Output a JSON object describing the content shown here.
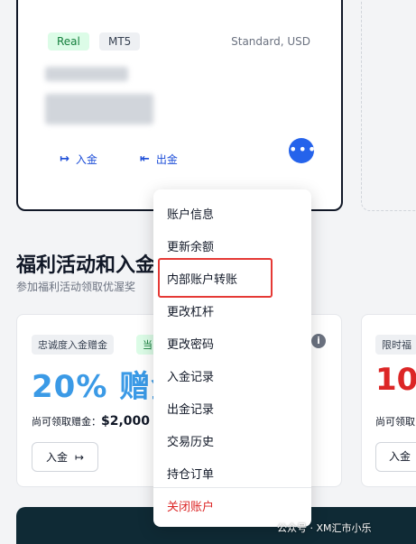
{
  "account": {
    "badges": [
      "Real",
      "MT5"
    ],
    "type": "Standard, USD",
    "deposit_label": "入金",
    "withdraw_label": "出金",
    "more_label": "•••"
  },
  "section": {
    "title": "福利活动和入金",
    "subtitle": "参加福利活动领取优渥奖"
  },
  "promo1": {
    "tag1": "忠诚度入金赠金",
    "tag2": "当",
    "big": "20% 赠金",
    "label": "尚可领取赠金：",
    "amount": "$2,000",
    "button": "入金"
  },
  "promo2": {
    "tag": "限时福",
    "big": "10",
    "label": "尚可领取",
    "button": "入金"
  },
  "menu": {
    "items": [
      "账户信息",
      "更新余额",
      "内部账户转账",
      "更改杠杆",
      "更改密码",
      "入金记录",
      "出金记录",
      "交易历史",
      "持仓订单"
    ],
    "danger_item": "关闭账户"
  },
  "watermark": "公众号 · XM汇市小乐",
  "colors": {
    "accent_blue": "#2563eb",
    "promo_blue": "#3b9ae6",
    "promo_red": "#dc2626",
    "highlight": "#e53935"
  }
}
